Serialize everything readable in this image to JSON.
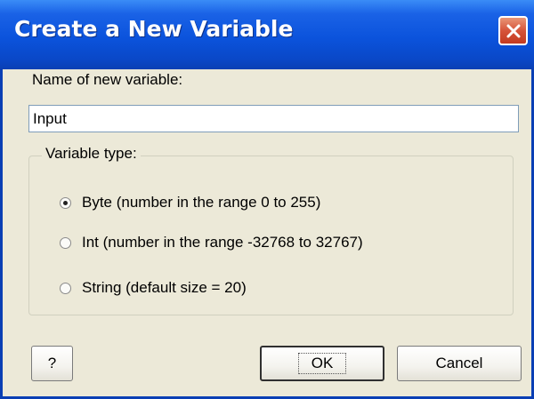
{
  "window": {
    "title": "Create a New Variable",
    "close_icon": "close-x-icon",
    "accent_color": "#0b53dc",
    "close_color": "#d6543a"
  },
  "form": {
    "name_label": "Name of new variable:",
    "name_value": "Input"
  },
  "variable_type": {
    "group_label": "Variable type:",
    "options": [
      {
        "label": "Byte (number in the range 0 to 255)",
        "selected": true
      },
      {
        "label": "Int (number in the range -32768 to 32767)",
        "selected": false
      },
      {
        "label": "String (default size = 20)",
        "selected": false
      }
    ]
  },
  "buttons": {
    "help_label": "?",
    "ok_label": "OK",
    "cancel_label": "Cancel"
  }
}
